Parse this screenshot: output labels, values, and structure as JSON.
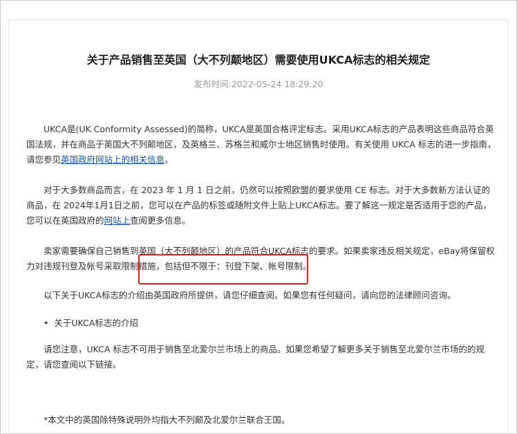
{
  "article": {
    "title": "关于产品销售至英国（大不列颠地区）需要使用UKCA标志的相关规定",
    "published": "发布时间:2022-05-24 18:29:20",
    "p1_text": "UKCA是(UK Conformity Assessed)的简称，UKCA是英国合格评定标志。采用UKCA标志的产品表明这些商品符合英国法规，并在商品于英国大不列颠地区，及英格兰、苏格兰和威尔士地区销售时使用。有关使用 UKCA 标志的进一步指南，请您参见",
    "p1_link": "英国政府网站上的相关信息",
    "p1_end": "。",
    "p2_text": "对于大多数商品而言，在 2023 年 1 月 1 日之前，仍然可以按照欧盟的要求使用 CE 标志。对于大多数新方法认证的商品，在 2024年1月1日之前，您可以在产品的标签或随附文件上贴上UKCA标志。要了解这一规定是否适用于您的产品，您可以在英国政府的",
    "p2_link": "网站上",
    "p2_end": "查阅更多信息。",
    "p3_text": "卖家需要确保自己销售到英国（大不列颠地区）的产品符合UKCA标志的要求。如果卖家违反相关规定，eBay将保留权力对违规刊登及帐号采取限制措施，包括但不限于：刊登下架、帐号限制。",
    "p4_text": "以下关于UKCA标志的介绍由英国政府所提供，请您仔细查阅。如果您有任何疑问，请向您的法律顾问咨询。",
    "bullet_symbol": "•",
    "bullet_text": "关于UKCA标志的介绍",
    "p6_text": "请您注意，UKCA 标志不可用于销售至北爱尔兰市场上的商品。如果您希望了解更多关于销售至北爱尔兰市场的的规定，请您查阅以下链接。",
    "footnote": "*本文中的英国除特殊说明外均指大不列颠及北爱尔兰联合王国。"
  },
  "colors": {
    "link": "#1a4fb0",
    "highlight": "#e02020",
    "meta": "#9a9a9a"
  }
}
